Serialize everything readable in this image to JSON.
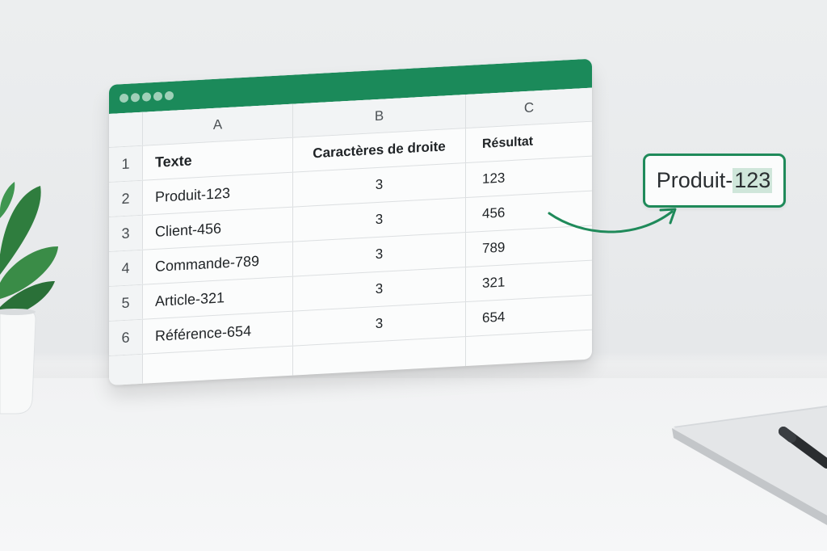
{
  "window": {
    "accent_color": "#1b8a5a",
    "titlebar_dots": 5
  },
  "sheet": {
    "column_headers": [
      "A",
      "B",
      "C"
    ],
    "header_row": {
      "row_number": "1",
      "a": "Texte",
      "b": "Caractères de droite",
      "c": "Résultat"
    },
    "rows": [
      {
        "row_number": "2",
        "a": "Produit-123",
        "b": "3",
        "c": "123"
      },
      {
        "row_number": "3",
        "a": "Client-456",
        "b": "3",
        "c": "456"
      },
      {
        "row_number": "4",
        "a": "Commande-789",
        "b": "3",
        "c": "789"
      },
      {
        "row_number": "5",
        "a": "Article-321",
        "b": "3",
        "c": "321"
      },
      {
        "row_number": "6",
        "a": "Référence-654",
        "b": "3",
        "c": "654"
      }
    ]
  },
  "callout": {
    "prefix": "Produit-",
    "highlight": "123",
    "highlight_color": "#cfe6da"
  }
}
